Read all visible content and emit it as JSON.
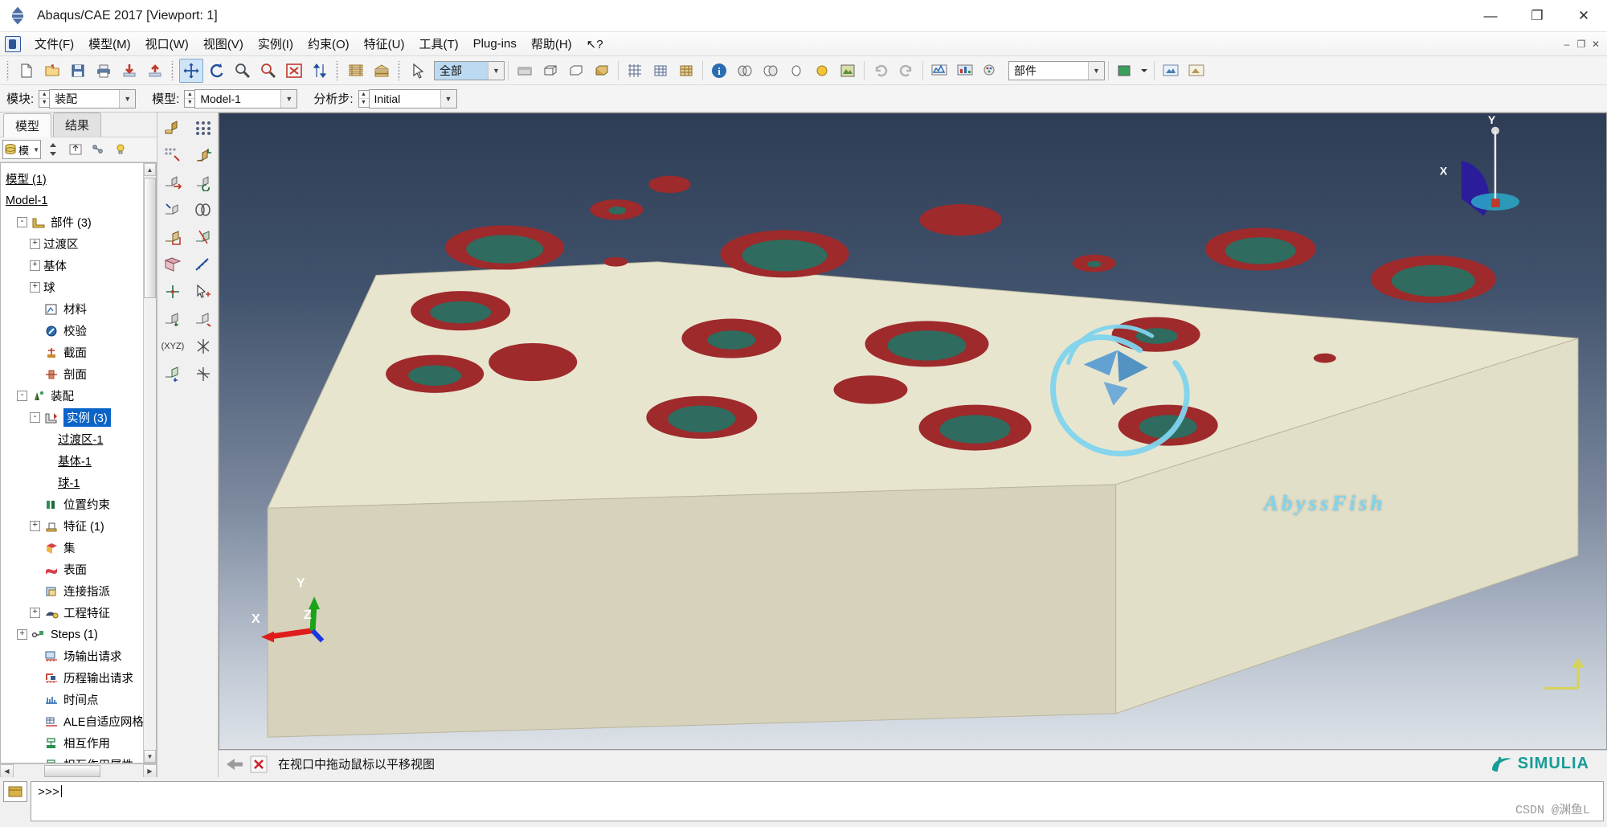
{
  "window": {
    "title": "Abaqus/CAE 2017 [Viewport: 1]",
    "minimize": "—",
    "maximize": "❐",
    "close": "✕"
  },
  "menubar": {
    "items": [
      {
        "label": "文件(F)"
      },
      {
        "label": "模型(M)"
      },
      {
        "label": "视口(W)"
      },
      {
        "label": "视图(V)"
      },
      {
        "label": "实例(I)"
      },
      {
        "label": "约束(O)"
      },
      {
        "label": "特征(U)"
      },
      {
        "label": "工具(T)"
      },
      {
        "label": "Plug-ins"
      },
      {
        "label": "帮助(H)"
      },
      {
        "label": "↖?"
      }
    ],
    "win_minimize": "–",
    "win_restore": "❐",
    "win_close": "✕"
  },
  "toolbar": {
    "filter_value": "全部",
    "part_value": "部件",
    "icons": [
      "new-file-icon",
      "open-folder-icon",
      "save-icon",
      "print-icon",
      "import-icon",
      "export-icon",
      "pan-icon",
      "rotate-icon",
      "zoom-in-icon",
      "zoom-out-icon",
      "zoom-box-icon",
      "sort-icon",
      "layer-icon",
      "layer2-icon",
      "cursor-icon"
    ]
  },
  "contextbar": {
    "module_label": "模块:",
    "module_value": "装配",
    "model_label": "模型:",
    "model_value": "Model-1",
    "step_label": "分析步:",
    "step_value": "Initial"
  },
  "leftpanel": {
    "tabs": [
      {
        "label": "模型",
        "selected": true
      },
      {
        "label": "结果",
        "selected": false
      }
    ],
    "model_combo_value": "模",
    "tree": [
      {
        "label": "模型 (1)",
        "indent": 0,
        "toggle": "",
        "icon": "",
        "underline": true,
        "selected": false
      },
      {
        "label": "Model-1",
        "indent": 0,
        "toggle": "",
        "icon": "",
        "underline": true,
        "selected": false
      },
      {
        "label": "部件 (3)",
        "indent": 1,
        "toggle": "-",
        "icon": "part-icon",
        "underline": false,
        "selected": false
      },
      {
        "label": "过渡区",
        "indent": 2,
        "toggle": "+",
        "icon": "",
        "underline": false,
        "selected": false
      },
      {
        "label": "基体",
        "indent": 2,
        "toggle": "+",
        "icon": "",
        "underline": false,
        "selected": false
      },
      {
        "label": "球",
        "indent": 2,
        "toggle": "+",
        "icon": "",
        "underline": false,
        "selected": false
      },
      {
        "label": "材料",
        "indent": 2,
        "toggle": "",
        "icon": "material-icon",
        "underline": false,
        "selected": false
      },
      {
        "label": "校验",
        "indent": 2,
        "toggle": "",
        "icon": "calibration-icon",
        "underline": false,
        "selected": false
      },
      {
        "label": "截面",
        "indent": 2,
        "toggle": "",
        "icon": "section-icon",
        "underline": false,
        "selected": false
      },
      {
        "label": "剖面",
        "indent": 2,
        "toggle": "",
        "icon": "profile-icon",
        "underline": false,
        "selected": false
      },
      {
        "label": "装配",
        "indent": 1,
        "toggle": "-",
        "icon": "assembly-icon",
        "underline": false,
        "selected": false
      },
      {
        "label": "实例 (3)",
        "indent": 2,
        "toggle": "-",
        "icon": "instance-icon",
        "underline": false,
        "selected": true
      },
      {
        "label": "过渡区-1",
        "indent": 3,
        "toggle": "",
        "icon": "",
        "underline": true,
        "selected": false
      },
      {
        "label": "基体-1",
        "indent": 3,
        "toggle": "",
        "icon": "",
        "underline": true,
        "selected": false
      },
      {
        "label": "球-1",
        "indent": 3,
        "toggle": "",
        "icon": "",
        "underline": true,
        "selected": false
      },
      {
        "label": "位置约束",
        "indent": 2,
        "toggle": "",
        "icon": "constraint-icon",
        "underline": false,
        "selected": false
      },
      {
        "label": "特征 (1)",
        "indent": 2,
        "toggle": "+",
        "icon": "feature-icon",
        "underline": false,
        "selected": false
      },
      {
        "label": "集",
        "indent": 2,
        "toggle": "",
        "icon": "set-icon",
        "underline": false,
        "selected": false
      },
      {
        "label": "表面",
        "indent": 2,
        "toggle": "",
        "icon": "surface-icon",
        "underline": false,
        "selected": false
      },
      {
        "label": "连接指派",
        "indent": 2,
        "toggle": "",
        "icon": "connector-icon",
        "underline": false,
        "selected": false
      },
      {
        "label": "工程特征",
        "indent": 2,
        "toggle": "+",
        "icon": "engineering-icon",
        "underline": false,
        "selected": false
      },
      {
        "label": "Steps (1)",
        "indent": 1,
        "toggle": "+",
        "icon": "steps-icon",
        "underline": false,
        "selected": false
      },
      {
        "label": "场输出请求",
        "indent": 2,
        "toggle": "",
        "icon": "field-output-icon",
        "underline": false,
        "selected": false
      },
      {
        "label": "历程输出请求",
        "indent": 2,
        "toggle": "",
        "icon": "history-output-icon",
        "underline": false,
        "selected": false
      },
      {
        "label": "时间点",
        "indent": 2,
        "toggle": "",
        "icon": "time-point-icon",
        "underline": false,
        "selected": false
      },
      {
        "label": "ALE自适应网格",
        "indent": 2,
        "toggle": "",
        "icon": "ale-mesh-icon",
        "underline": false,
        "selected": false
      },
      {
        "label": "相互作用",
        "indent": 2,
        "toggle": "",
        "icon": "interaction-icon",
        "underline": false,
        "selected": false
      },
      {
        "label": "相互作用属性",
        "indent": 2,
        "toggle": "",
        "icon": "interaction-prop-icon",
        "underline": false,
        "selected": false
      }
    ]
  },
  "viewport": {
    "watermark": "AbyssFish",
    "triad_main": {
      "x": "X",
      "y": "Y",
      "z": "Z"
    },
    "triad_corner": {
      "x": "X",
      "y": "Y"
    },
    "colors": {
      "part_beige": "#e8e5cf",
      "part_beige_dark": "#cdc9b2",
      "hole_red": "#9e2a2b",
      "hole_green": "#2f6b5e",
      "bg_top": "#2e3d55",
      "bg_bottom": "#dde2e8",
      "axis_x": "#e01b1b",
      "axis_y": "#19a319",
      "axis_z": "#1b35e0"
    }
  },
  "statusbar": {
    "back_icon": "back-arrow-icon",
    "cancel_icon": "cancel-x-icon",
    "message": "在视口中拖动鼠标以平移视图",
    "brand": "SIMULIA"
  },
  "command": {
    "prompt": ">>>",
    "value": "",
    "watermark": "CSDN @渊鱼L"
  }
}
